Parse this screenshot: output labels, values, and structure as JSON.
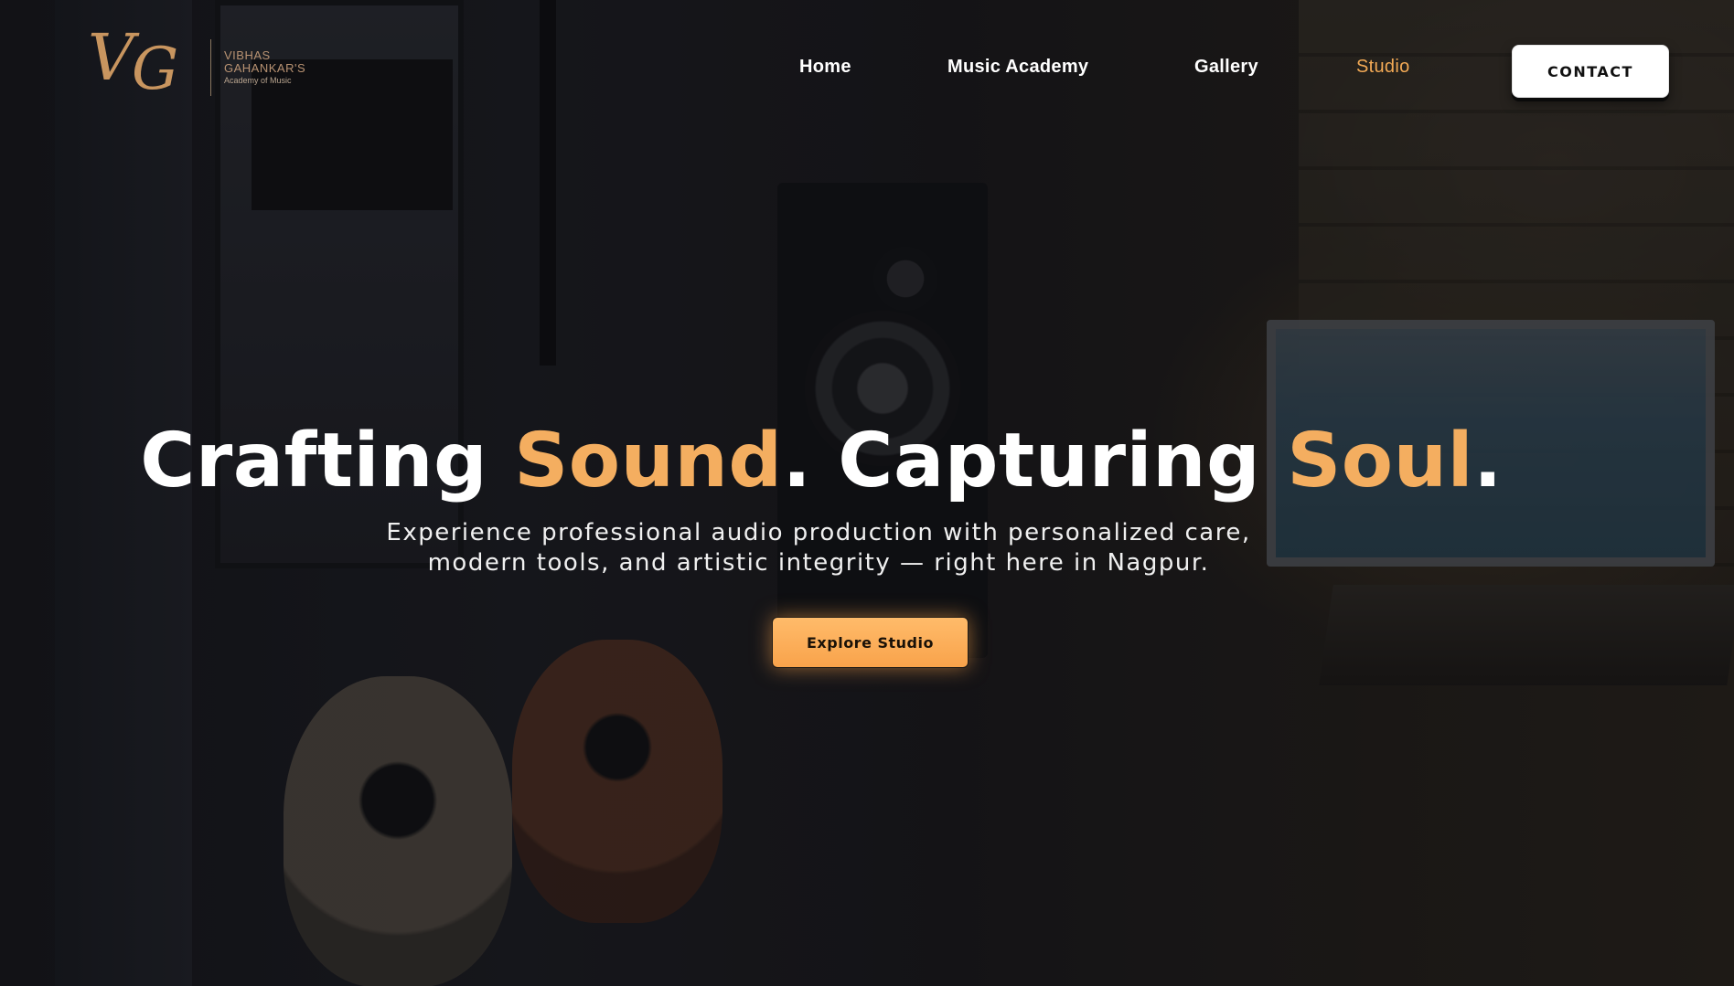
{
  "brand": {
    "monogram_v": "V",
    "monogram_g": "G",
    "line1": "VIBHAS",
    "line2": "GAHANKAR'S",
    "line3": "Academy of Music"
  },
  "nav": {
    "items": [
      {
        "label": "Home",
        "active": false
      },
      {
        "label": "Music Academy",
        "active": false
      },
      {
        "label": "Gallery",
        "active": false
      },
      {
        "label": "Studio",
        "active": true
      }
    ],
    "contact_label": "CONTACT"
  },
  "hero": {
    "title_part1": "Crafting ",
    "title_accent1": "Sound",
    "title_part2": ". Capturing ",
    "title_accent2": "Soul",
    "title_part3": ".",
    "subtitle_line1": "Experience professional audio production with personalized care,",
    "subtitle_line2": "modern tools, and artistic integrity — right here in Nagpur.",
    "cta_label": "Explore Studio"
  },
  "colors": {
    "accent": "#f4ae60",
    "button": "#f9a34b",
    "text": "#ffffff"
  }
}
